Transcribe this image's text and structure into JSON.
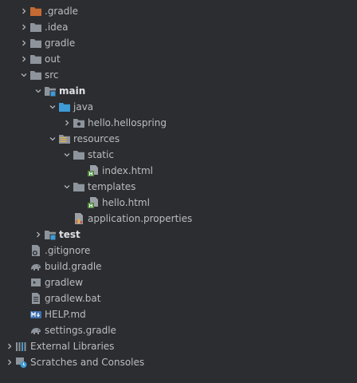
{
  "colors": {
    "background": "#2b2d30",
    "text": "#bbbdc0",
    "folder": "#8e949c",
    "folder_excluded": "#c56a32",
    "source_marker": "#3d9bd6",
    "html_green": "#4f8a3d"
  },
  "tree": [
    {
      "label": ".gradle",
      "depth": 1,
      "arrow": "collapsed",
      "icon": "folder-excluded-icon"
    },
    {
      "label": ".idea",
      "depth": 1,
      "arrow": "collapsed",
      "icon": "folder-icon"
    },
    {
      "label": "gradle",
      "depth": 1,
      "arrow": "collapsed",
      "icon": "folder-icon"
    },
    {
      "label": "out",
      "depth": 1,
      "arrow": "collapsed",
      "icon": "folder-icon"
    },
    {
      "label": "src",
      "depth": 1,
      "arrow": "expanded",
      "icon": "folder-icon"
    },
    {
      "label": "main",
      "depth": 2,
      "arrow": "expanded",
      "icon": "module-folder-icon",
      "bold": true
    },
    {
      "label": "java",
      "depth": 3,
      "arrow": "expanded",
      "icon": "source-folder-icon"
    },
    {
      "label": "hello.hellospring",
      "depth": 4,
      "arrow": "collapsed",
      "icon": "package-icon"
    },
    {
      "label": "resources",
      "depth": 3,
      "arrow": "expanded",
      "icon": "resources-folder-icon"
    },
    {
      "label": "static",
      "depth": 4,
      "arrow": "expanded",
      "icon": "folder-icon"
    },
    {
      "label": "index.html",
      "depth": 5,
      "arrow": "none",
      "icon": "html-file-icon"
    },
    {
      "label": "templates",
      "depth": 4,
      "arrow": "expanded",
      "icon": "folder-icon"
    },
    {
      "label": "hello.html",
      "depth": 5,
      "arrow": "none",
      "icon": "html-file-icon"
    },
    {
      "label": "application.properties",
      "depth": 4,
      "arrow": "none",
      "icon": "properties-file-icon"
    },
    {
      "label": "test",
      "depth": 2,
      "arrow": "collapsed",
      "icon": "module-folder-icon",
      "bold": true
    },
    {
      "label": ".gitignore",
      "depth": 1,
      "arrow": "none",
      "icon": "gitignore-file-icon"
    },
    {
      "label": "build.gradle",
      "depth": 1,
      "arrow": "none",
      "icon": "gradle-elephant-icon"
    },
    {
      "label": "gradlew",
      "depth": 1,
      "arrow": "none",
      "icon": "shell-script-icon"
    },
    {
      "label": "gradlew.bat",
      "depth": 1,
      "arrow": "none",
      "icon": "text-file-icon"
    },
    {
      "label": "HELP.md",
      "depth": 1,
      "arrow": "none",
      "icon": "markdown-file-icon"
    },
    {
      "label": "settings.gradle",
      "depth": 1,
      "arrow": "none",
      "icon": "gradle-elephant-icon"
    },
    {
      "label": "External Libraries",
      "depth": 0,
      "arrow": "collapsed",
      "icon": "libraries-icon"
    },
    {
      "label": "Scratches and Consoles",
      "depth": 0,
      "arrow": "collapsed",
      "icon": "scratches-icon"
    }
  ]
}
